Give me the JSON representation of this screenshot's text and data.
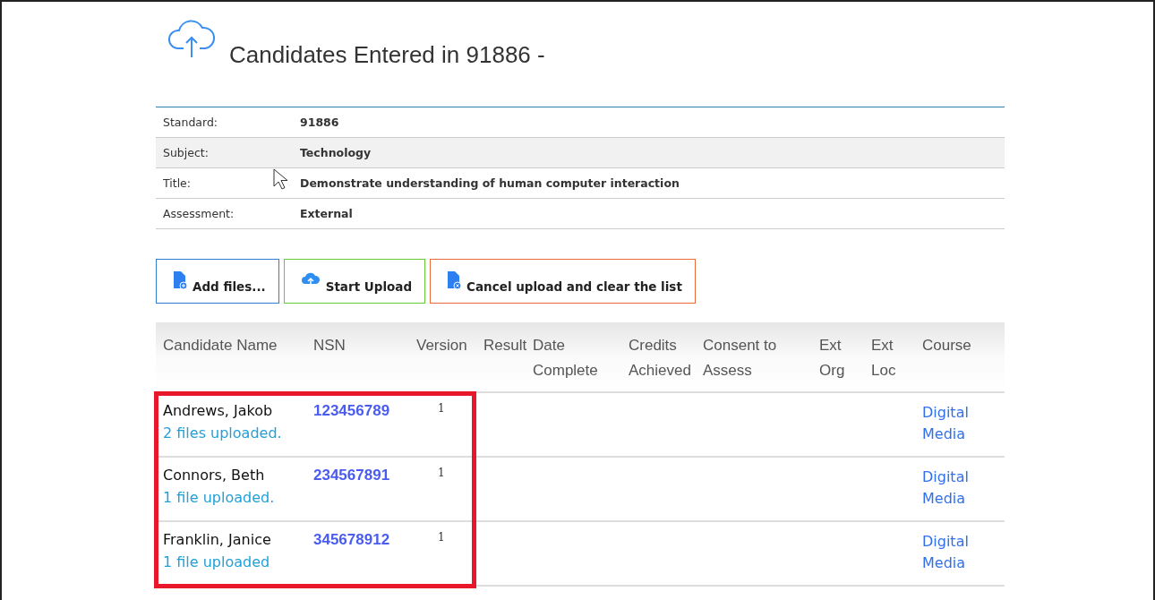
{
  "title": "Candidates Entered in 91886 -",
  "details": [
    {
      "label": "Standard:",
      "value": "91886",
      "shaded": false
    },
    {
      "label": "Subject:",
      "value": "Technology",
      "shaded": true
    },
    {
      "label": "Title:",
      "value": "Demonstrate understanding of human computer interaction",
      "shaded": false
    },
    {
      "label": "Assessment:",
      "value": "External",
      "shaded": false
    }
  ],
  "buttons": [
    {
      "label": "Add files...",
      "kind": "add"
    },
    {
      "label": "Start Upload",
      "kind": "start"
    },
    {
      "label": "Cancel upload and clear the list",
      "kind": "cancel"
    }
  ],
  "table": {
    "columns": [
      [
        "Candidate Name"
      ],
      [
        "NSN"
      ],
      [
        "Version"
      ],
      [
        "Result"
      ],
      [
        "Date",
        "Complete"
      ],
      [
        "Credits",
        "Achieved"
      ],
      [
        "Consent to",
        "Assess"
      ],
      [
        "Ext",
        "Org"
      ],
      [
        "Ext",
        "Loc"
      ],
      [
        "Course"
      ]
    ],
    "rows": [
      {
        "name": "Andrews, Jakob",
        "status": "2 files uploaded.",
        "nsn": "123456789",
        "version": "1",
        "course": [
          "Digital",
          "Media"
        ]
      },
      {
        "name": "Connors, Beth",
        "status": "1 file uploaded.",
        "nsn": "234567891",
        "version": "1",
        "course": [
          "Digital",
          "Media"
        ]
      },
      {
        "name": "Franklin, Janice",
        "status": "1 file uploaded",
        "nsn": "345678912",
        "version": "1",
        "course": [
          "Digital",
          "Media"
        ]
      }
    ]
  }
}
